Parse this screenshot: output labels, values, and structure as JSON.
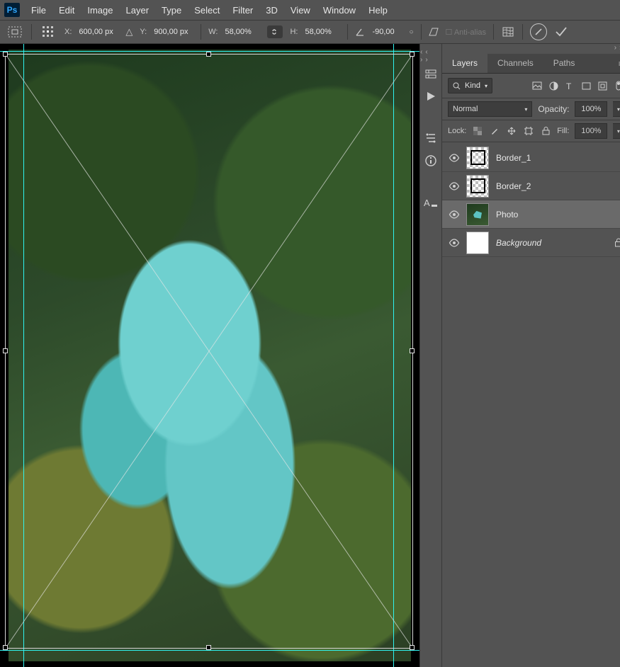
{
  "menu": [
    "File",
    "Edit",
    "Image",
    "Layer",
    "Type",
    "Select",
    "Filter",
    "3D",
    "View",
    "Window",
    "Help"
  ],
  "options": {
    "x_label": "X:",
    "x": "600,00 px",
    "y_label": "Y:",
    "y": "900,00 px",
    "w_label": "W:",
    "w": "58,00%",
    "h_label": "H:",
    "h": "58,00%",
    "angle": "-90,00",
    "antialias": "Anti-alias"
  },
  "panel": {
    "tabs": [
      "Layers",
      "Channels",
      "Paths"
    ],
    "kind_label": "Kind",
    "blend": "Normal",
    "opacity_label": "Opacity:",
    "opacity": "100%",
    "lock_label": "Lock:",
    "fill_label": "Fill:",
    "fill": "100%"
  },
  "layers": [
    {
      "name": "Border_1",
      "thumb": "checker-border",
      "italic": false,
      "locked": false,
      "selected": false
    },
    {
      "name": "Border_2",
      "thumb": "checker-border",
      "italic": false,
      "locked": false,
      "selected": false
    },
    {
      "name": "Photo",
      "thumb": "photo",
      "italic": false,
      "locked": false,
      "selected": true
    },
    {
      "name": "Background",
      "thumb": "white",
      "italic": true,
      "locked": true,
      "selected": false
    }
  ]
}
